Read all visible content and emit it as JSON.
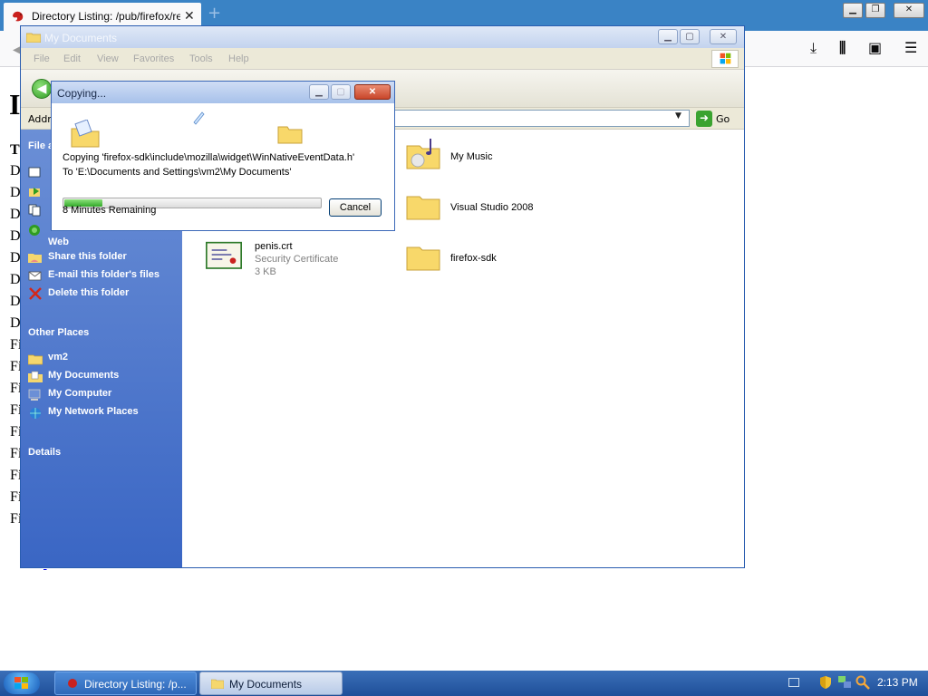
{
  "browser": {
    "tab_title": "Directory Listing: /pub/firefox/releases/",
    "tab_close": "✕",
    "new_tab": "+"
  },
  "web": {
    "heading": "I",
    "rows": [
      "T",
      "D",
      "D",
      "D",
      "D",
      "D",
      "D",
      "D",
      "D",
      "Fi",
      "Fi",
      "Fi",
      "Fi",
      "Fi",
      "Fi",
      "Fi",
      "Fi",
      "Fi"
    ]
  },
  "explorer": {
    "title": "My Documents",
    "menu": [
      "File",
      "Edit",
      "View",
      "Favorites",
      "Tools",
      "Help"
    ],
    "address_label": "Addr",
    "go_label": "Go",
    "taskpane": {
      "file_tasks_head": "File a",
      "web_label": "Web",
      "share": "Share this folder",
      "email": "E-mail this folder's files",
      "delete": "Delete this folder",
      "other_places_head": "Other Places",
      "places": [
        "vm2",
        "My Documents",
        "My Computer",
        "My Network Places"
      ],
      "details_head": "Details"
    },
    "files": {
      "my_music": "My Music",
      "visual_studio": "Visual Studio 2008",
      "firefox_sdk": "firefox-sdk",
      "cert_name": "penis.crt",
      "cert_type": "Security Certificate",
      "cert_size": "3 KB"
    }
  },
  "copy_dialog": {
    "title": "Copying...",
    "line1": "Copying 'firefox-sdk\\include\\mozilla\\widget\\WinNativeEventData.h'",
    "line2": "To 'E:\\Documents and Settings\\vm2\\My Documents'",
    "progress": 0.15,
    "remaining": "8 Minutes Remaining",
    "cancel": "Cancel"
  },
  "taskbar": {
    "items": [
      "Directory Listing: /p...",
      "My Documents"
    ],
    "clock": "2:13 PM"
  }
}
